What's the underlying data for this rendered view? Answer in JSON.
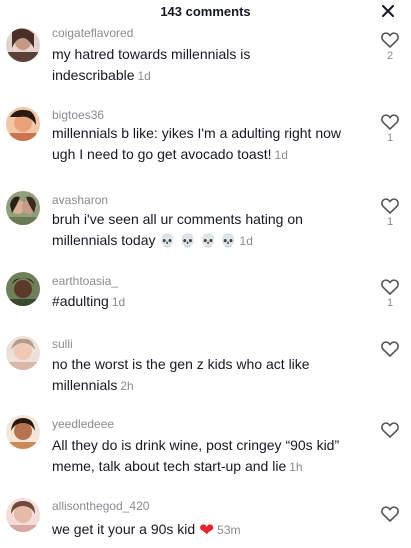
{
  "header": {
    "title": "143 comments",
    "close_icon": "close-icon"
  },
  "comments": [
    {
      "username": "coigateflavored",
      "text": "my hatred towards millennials is indescribable",
      "time": "1d",
      "likes": "2",
      "avatar_color": "#5b4038"
    },
    {
      "username": "bigtoes36",
      "text": "millennials b like: yikes I'm a  adulting right now ugh I need to go get avocado toast!",
      "time": "1d",
      "likes": "1",
      "avatar_color": "#c9744d"
    },
    {
      "username": "avasharon",
      "text": "bruh i've seen all ur comments hating on millennials today",
      "emoji": "💀 💀 💀 💀",
      "time": "1d",
      "likes": "1",
      "avatar_color": "#6b7a55"
    },
    {
      "username": "earthtoasia_",
      "text": "#adulting",
      "time": "1d",
      "likes": "1",
      "avatar_color": "#3a4a2e"
    },
    {
      "username": "sulli",
      "text": "no the worst is the gen z kids who act like millennials",
      "time": "2h",
      "likes": "",
      "avatar_color": "#d9b8a8"
    },
    {
      "username": "yeedledeee",
      "text": "All they do is drink wine, post cringey “90s kid” meme, talk about tech start-up and lie",
      "time": "1h",
      "likes": "",
      "avatar_color": "#c98a55"
    },
    {
      "username": "allisonthegod_420",
      "text": "we get it your a 90s kid",
      "emoji": "❤",
      "time": "53m",
      "likes": "",
      "avatar_color": "#d7a7a0"
    }
  ]
}
